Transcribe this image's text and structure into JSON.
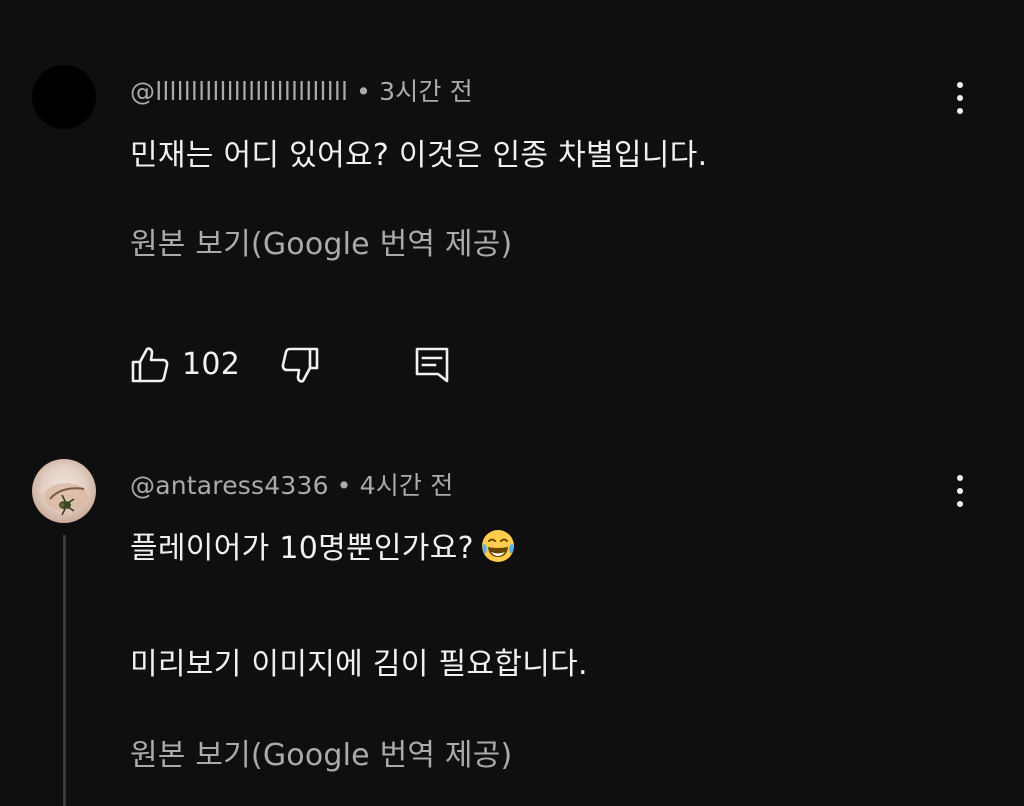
{
  "comments": [
    {
      "username": "@lllllllllllllllllllllllllll",
      "separator": "•",
      "time": "3시간 전",
      "text": "민재는 어디 있어요? 이것은 인종 차별입니다.",
      "translate_link": "원본 보기(Google 번역 제공)",
      "like_count": "102",
      "icons": [
        "thumbs-up-icon",
        "thumbs-down-icon",
        "reply-icon",
        "more-vert-icon"
      ]
    },
    {
      "username": "@antaress4336",
      "separator": "•",
      "time": "4시간 전",
      "text_line1": "플레이어가 10명뿐인가요?",
      "text_line2": "미리보기 이미지에 김이 필요합니다.",
      "translate_link": "원본 보기(Google 번역 제공)",
      "icons": [
        "tears-of-joy-emoji-icon",
        "more-vert-icon"
      ]
    }
  ],
  "colors": {
    "background": "#0f0f0f",
    "primary_text": "#f1f1f1",
    "secondary_text": "#aaaaaa"
  }
}
